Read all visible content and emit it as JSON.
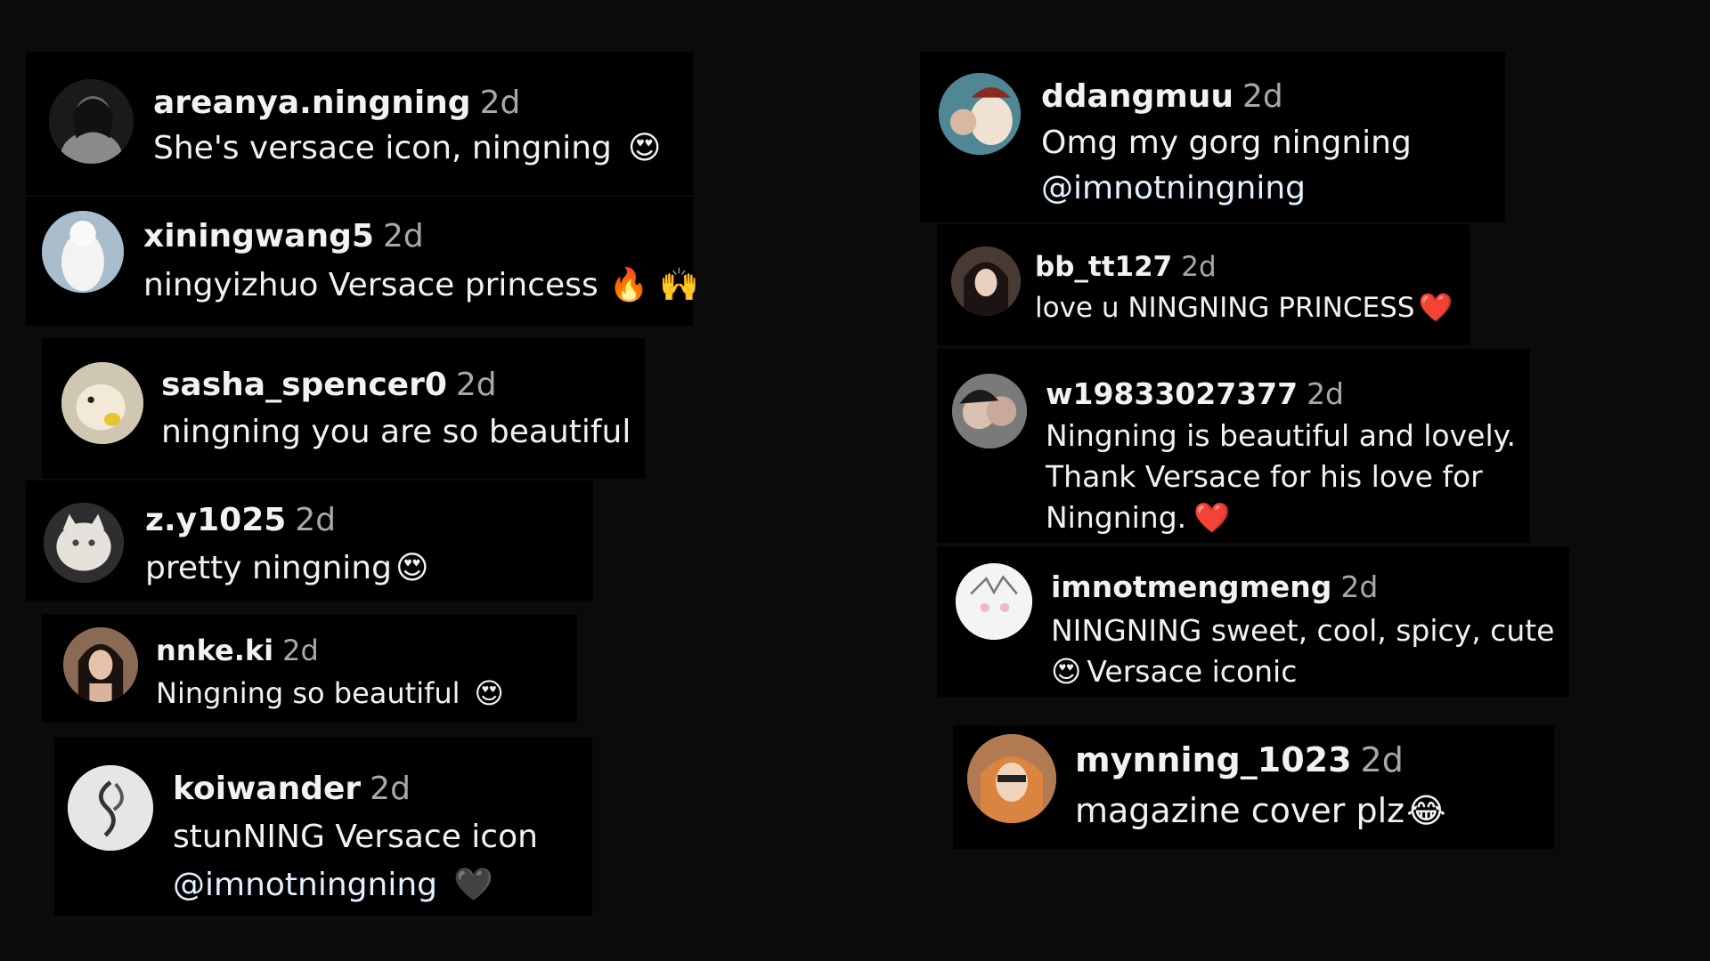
{
  "comments": [
    {
      "username": "areanya.ningning",
      "time": "2d",
      "text": "She's versace icon, ningning",
      "emoji": "😍",
      "avatar_icon": "portrait-bw-avatar"
    },
    {
      "username": "xiningwang5",
      "time": "2d",
      "text": "ningyizhuo Versace princess",
      "emoji": "🔥 🙌",
      "avatar_icon": "white-pet-avatar"
    },
    {
      "username": "sasha_spencer0",
      "time": "2d",
      "text": "ningning you are so beautiful",
      "emoji": "",
      "avatar_icon": "dog-avatar"
    },
    {
      "username": "z.y1025",
      "time": "2d",
      "text": "pretty ningning",
      "emoji": "😍",
      "avatar_icon": "cat-avatar"
    },
    {
      "username": "nnke.ki",
      "time": "2d",
      "text": "Ningning so beautiful",
      "emoji": "😍",
      "avatar_icon": "portrait-avatar"
    },
    {
      "username": "koiwander",
      "time": "2d",
      "line1": "stunNING Versace icon",
      "mention": "@imnotningning",
      "emoji": "🖤",
      "avatar_icon": "koi-fish-avatar"
    },
    {
      "username": "ddangmuu",
      "time": "2d",
      "line1": "Omg my gorg ningning",
      "mention": "@imnotningning",
      "avatar_icon": "cartoon-avatar"
    },
    {
      "username": "bb_tt127",
      "time": "2d",
      "text": "love u NINGNING PRINCESS",
      "emoji": "❤️",
      "avatar_icon": "portrait-avatar"
    },
    {
      "username": "w19833027377",
      "time": "2d",
      "line1": "Ningning is beautiful and lovely.",
      "line2": "Thank Versace for his love for",
      "line3": "Ningning.",
      "emoji": "❤️",
      "avatar_icon": "couple-avatar"
    },
    {
      "username": "imnotmengmeng",
      "time": "2d",
      "line1": "NINGNING sweet, cool, spicy, cute",
      "line2": "Versace iconic",
      "emoji": "😍",
      "avatar_icon": "anime-sketch-avatar"
    },
    {
      "username": "mynning_1023",
      "time": "2d",
      "text": "magazine cover plz",
      "emoji": "😂",
      "avatar_icon": "redhead-avatar"
    }
  ],
  "colors": {
    "background": "#0b0b0b",
    "card": "#000000",
    "text": "#f2f2f2",
    "timestamp": "#a8a8a8",
    "mention": "#e0f1ff"
  }
}
